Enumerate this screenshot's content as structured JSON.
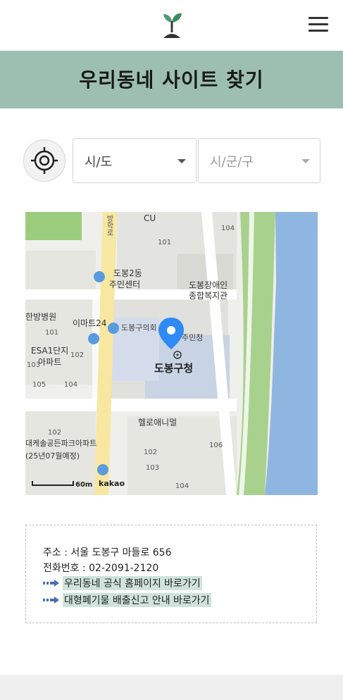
{
  "header": {
    "menu_label": "menu"
  },
  "banner": {
    "title": "우리동네 사이트 찾기"
  },
  "filters": {
    "sido": {
      "selected": "시/도"
    },
    "sigungu": {
      "selected": "시/군/구"
    }
  },
  "map": {
    "labels": {
      "cu": "CU",
      "dobong2": "도봉2동",
      "center": "주민센터",
      "disabled1": "도봉장애인",
      "disabled2": "종합복지관",
      "hospital": "한방병원",
      "emart": "이마트24",
      "council": "도봉구의회",
      "office_small": "주민청",
      "gu_office": "도봉구청",
      "esa1": "ESA1단지",
      "apt": "아파트",
      "helloanimal": "헬로애니멀",
      "park1": "대케솔공든파크아파트",
      "park2": "(25년07월예정)",
      "road": "방학로",
      "scale": "60m",
      "brand": "kakao",
      "n101a": "101",
      "n101b": "101",
      "n102": "102",
      "n103": "103",
      "n104a": "104",
      "n104b": "104",
      "n104c": "104",
      "n105": "105",
      "n106": "106",
      "n102b": "102",
      "n103b": "103",
      "n102c": "102"
    }
  },
  "info": {
    "address": "주소 : 서울 도봉구 마들로 656",
    "phone": "전화번호 : 02-2091-2120",
    "link_home": "우리동네 공식 홈페이지 바로가기",
    "link_waste": "대형폐기물 배출신고 안내 바로가기"
  },
  "colors": {
    "banner": "#9cbfb2",
    "highlight": "#cfe3dc",
    "river": "#8fb6e0",
    "park": "#a9d18e",
    "road_main": "#f7e7a1",
    "marker": "#2f8af5"
  }
}
